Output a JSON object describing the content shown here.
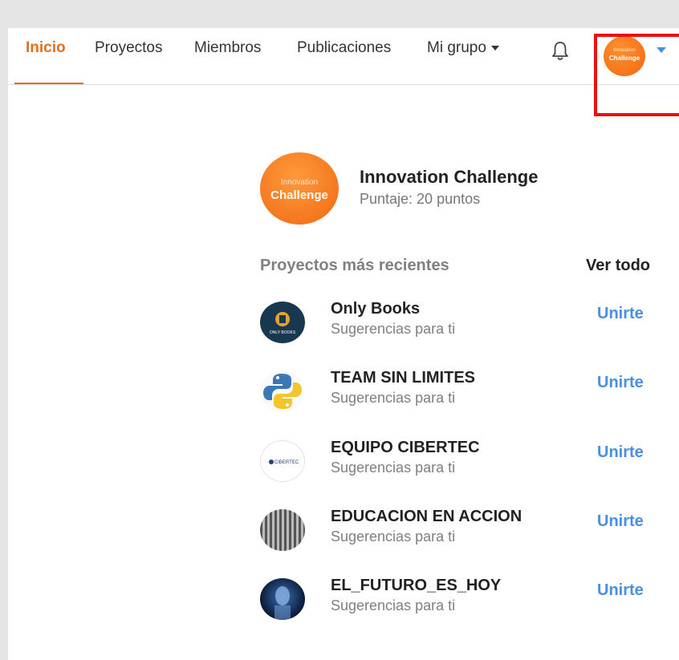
{
  "nav": {
    "items": [
      {
        "label": "Inicio",
        "active": true
      },
      {
        "label": "Proyectos"
      },
      {
        "label": "Miembros"
      },
      {
        "label": "Publicaciones"
      },
      {
        "label": "Mi grupo",
        "dropdown": true
      }
    ],
    "bell_icon": "bell-icon",
    "avatar_logo_line1": "Innovation",
    "avatar_logo_line2": "Challenge"
  },
  "profile": {
    "name": "Innovation Challenge",
    "score": "Puntaje: 20 puntos",
    "logo_line1": "Innovation",
    "logo_line2": "Challenge"
  },
  "recent": {
    "title": "Proyectos más recientes",
    "see_all": "Ver todo",
    "items": [
      {
        "name": "Only Books",
        "subtitle": "Sugerencias para ti",
        "action": "Unirte",
        "logo_text": "ONLY BOOKS"
      },
      {
        "name": "TEAM SIN LIMITES",
        "subtitle": "Sugerencias para ti",
        "action": "Unirte"
      },
      {
        "name": "EQUIPO CIBERTEC",
        "subtitle": "Sugerencias para ti",
        "action": "Unirte",
        "logo_text": "CIBERTEC"
      },
      {
        "name": "EDUCACION EN ACCION",
        "subtitle": "Sugerencias para ti",
        "action": "Unirte"
      },
      {
        "name": "EL_FUTURO_ES_HOY",
        "subtitle": "Sugerencias para ti",
        "action": "Unirte"
      }
    ]
  },
  "colors": {
    "accent": "#e07020",
    "link": "#4a8fe0",
    "highlight": "#ea1010"
  }
}
